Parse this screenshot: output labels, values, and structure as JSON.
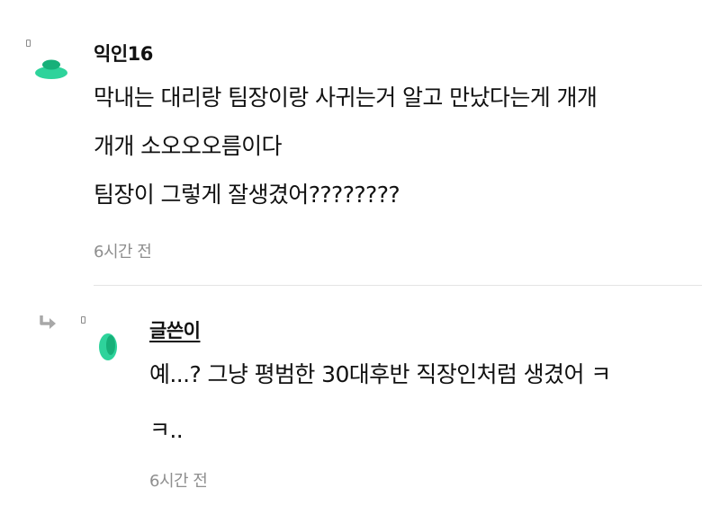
{
  "colors": {
    "accent_green": "#2ed39b",
    "accent_green_dark": "#17b079",
    "meta_gray": "#8e8e8e",
    "divider": "#e4e4e4"
  },
  "comments": [
    {
      "author": "익인16",
      "lines": [
        "막내는 대리랑 팀장이랑 사귀는거 알고 만났다는게 개개",
        "개개 소오오오름이다",
        "팀장이 그렇게 잘생겼어????????"
      ],
      "time": "6시간 전",
      "icon": "avatar-icon"
    },
    {
      "author": "글쓴이",
      "is_reply": true,
      "lines": [
        "예...? 그냥 평범한 30대후반 직장인처럼 생겼어 ㅋ",
        "ㅋ.."
      ],
      "time": "6시간 전",
      "icon": "avatar-icon"
    }
  ]
}
